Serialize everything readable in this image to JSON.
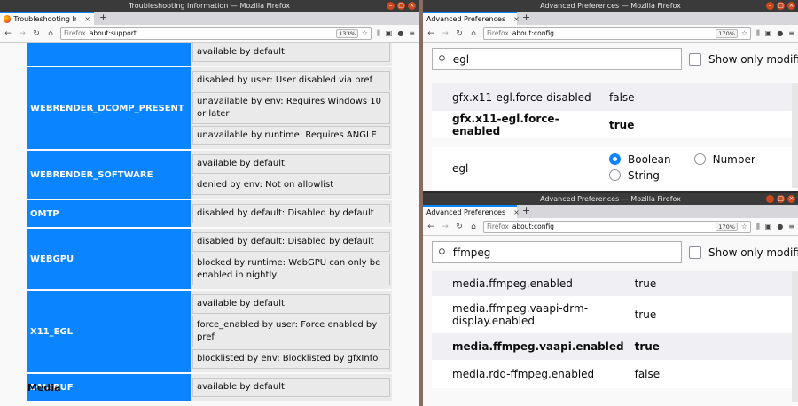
{
  "left": {
    "window_title": "Troubleshooting Information — Mozilla Firefox",
    "tab_label": "Troubleshooting Info",
    "identity": "Firefox",
    "url": "about:support",
    "zoom": "133%",
    "rows": [
      {
        "key": "",
        "values": [
          "available by default"
        ]
      },
      {
        "key": "WEBRENDER_DCOMP_PRESENT",
        "values": [
          "disabled by user: User disabled via pref",
          "unavailable by env: Requires Windows 10 or later",
          "unavailable by runtime: Requires ANGLE"
        ]
      },
      {
        "key": "WEBRENDER_SOFTWARE",
        "values": [
          "available by default",
          "denied by env: Not on allowlist"
        ]
      },
      {
        "key": "OMTP",
        "values": [
          "disabled by default: Disabled by default"
        ]
      },
      {
        "key": "WEBGPU",
        "values": [
          "disabled by default: Disabled by default",
          "blocked by runtime: WebGPU can only be enabled in nightly"
        ]
      },
      {
        "key": "X11_EGL",
        "values": [
          "available by default",
          "force_enabled by user: Force enabled by pref",
          "blocklisted by env: Blocklisted by gfxInfo"
        ]
      },
      {
        "key": "DMABUF",
        "values": [
          "available by default"
        ]
      }
    ],
    "section_heading": "Media"
  },
  "top_right": {
    "window_title": "Advanced Preferences — Mozilla Firefox",
    "tab_label": "Advanced Preferences",
    "identity": "Firefox",
    "url": "about:config",
    "zoom": "170%",
    "search_value": "egl",
    "show_only_modified": "Show only modifi",
    "prefs": [
      {
        "name": "gfx.x11-egl.force-disabled",
        "value": "false",
        "modified": false
      },
      {
        "name": "gfx.x11-egl.force-enabled",
        "value": "true",
        "modified": true
      }
    ],
    "new_pref": {
      "name": "egl",
      "options": [
        "Boolean",
        "Number",
        "String"
      ],
      "selected": "Boolean"
    }
  },
  "bottom_right": {
    "window_title": "Advanced Preferences — Mozilla Firefox",
    "tab_label": "Advanced Preferences",
    "identity": "Firefox",
    "url": "about:config",
    "zoom": "170%",
    "search_value": "ffmpeg",
    "show_only_modified": "Show only modifi",
    "prefs": [
      {
        "name": "media.ffmpeg.enabled",
        "value": "true",
        "modified": false
      },
      {
        "name": "media.ffmpeg.vaapi-drm-display.enabled",
        "value": "true",
        "modified": false
      },
      {
        "name": "media.ffmpeg.vaapi.enabled",
        "value": "true",
        "modified": true
      },
      {
        "name": "media.rdd-ffmpeg.enabled",
        "value": "false",
        "modified": false
      }
    ]
  },
  "colors": {
    "accent": "#0a84ff",
    "titlebar": "#3a3a3a",
    "close": "#c94a1f"
  }
}
